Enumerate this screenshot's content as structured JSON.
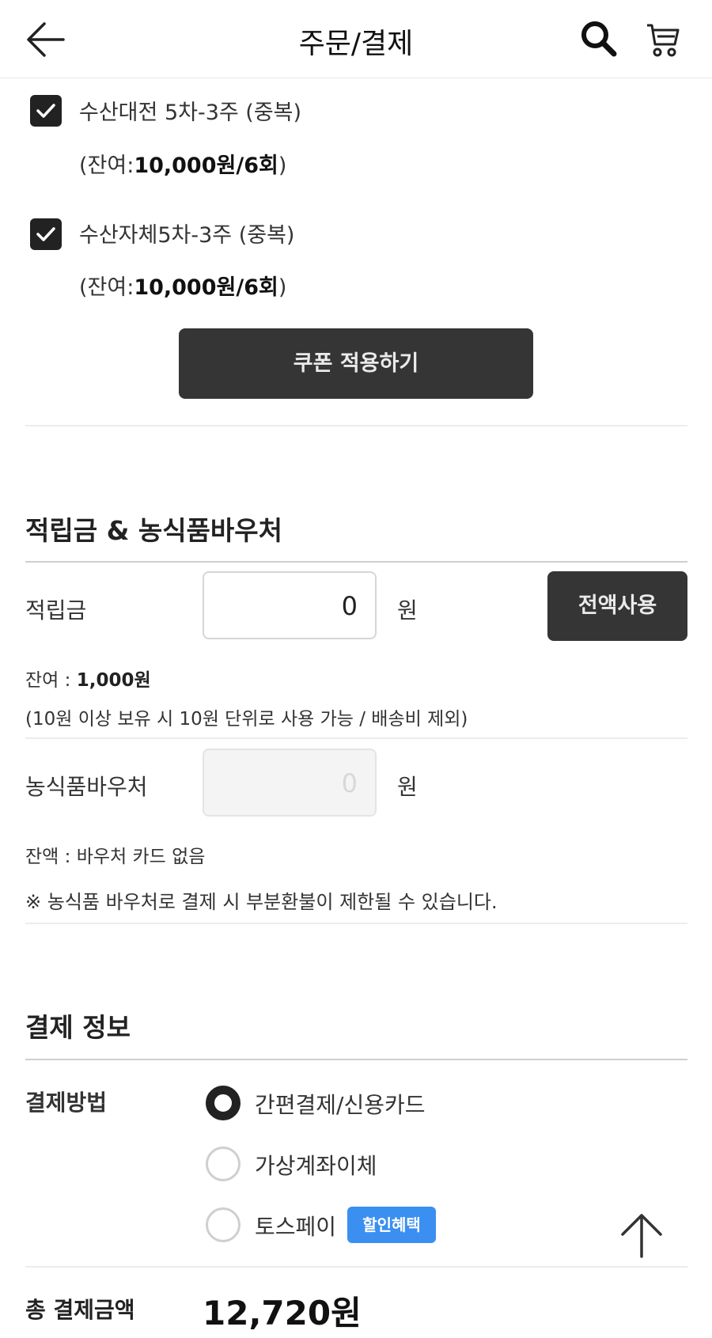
{
  "header": {
    "title": "주문/결제",
    "back_icon": "arrow-left-icon",
    "search_icon": "search-icon",
    "cart_icon": "cart-icon"
  },
  "coupons": [
    {
      "name": "수산대전 5차-3주 (중복)",
      "balance_prefix": "(잔여:",
      "balance_value": "10,000원/6회",
      "balance_suffix": ")",
      "checked": true
    },
    {
      "name": "수산자체5차-3주 (중복)",
      "balance_prefix": "(잔여:",
      "balance_value": "10,000원/6회",
      "balance_suffix": ")",
      "checked": true
    }
  ],
  "apply_coupon_label": "쿠폰 적용하기",
  "points_section": {
    "title": "적립금 & 농식품바우처",
    "points_label": "적립금",
    "points_value": "0",
    "unit": "원",
    "use_all_label": "전액사용",
    "balance_label": "잔여 : ",
    "balance_value": "1,000원",
    "note": "(10원 이상 보유 시 10원 단위로 사용 가능 / 배송비 제외)",
    "voucher_label": "농식품바우처",
    "voucher_value": "0",
    "voucher_balance": "잔액 : 바우처 카드 없음",
    "voucher_note": "※ 농식품 바우처로 결제 시 부분환불이 제한될 수 있습니다."
  },
  "payment": {
    "title": "결제 정보",
    "method_label": "결제방법",
    "methods": [
      {
        "label": "간편결제/신용카드",
        "selected": true
      },
      {
        "label": "가상계좌이체",
        "selected": false
      },
      {
        "label": "토스페이",
        "selected": false,
        "badge": "할인혜택"
      }
    ],
    "total_label": "총 결제금액",
    "total_value": "12,720원"
  },
  "scroll_top_icon": "arrow-up-icon",
  "colors": {
    "dark_button": "#353535",
    "badge_blue": "#3b8ff0",
    "text": "#222222"
  }
}
